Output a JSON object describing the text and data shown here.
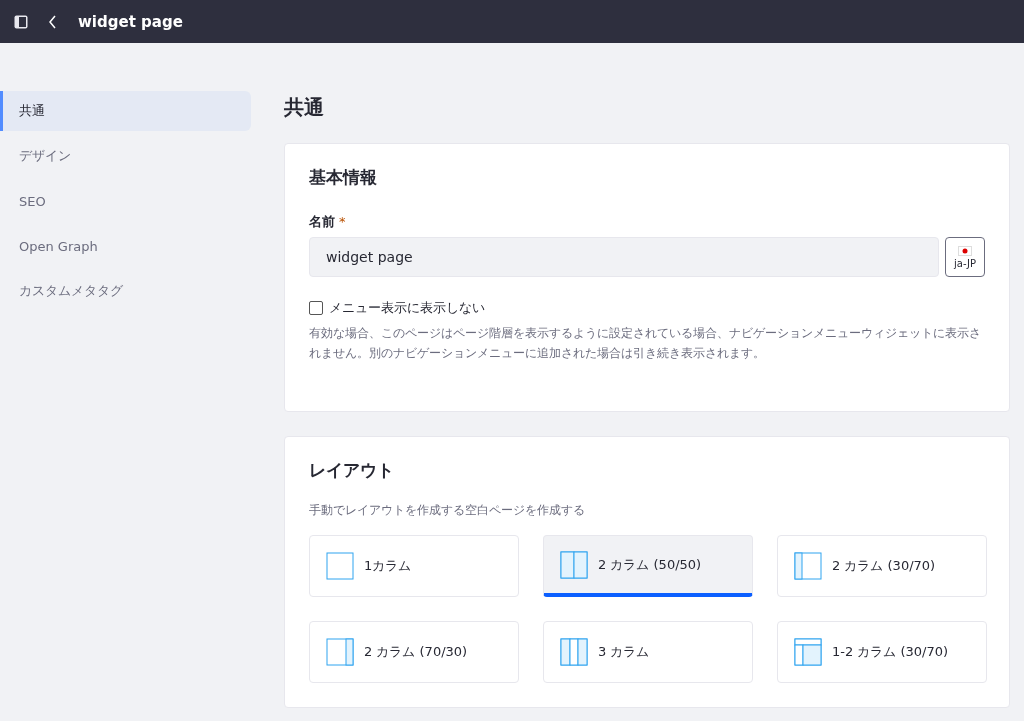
{
  "header": {
    "title": "widget page"
  },
  "sidebar": {
    "items": [
      {
        "label": "共通",
        "selected": true
      },
      {
        "label": "デザイン",
        "selected": false
      },
      {
        "label": "SEO",
        "selected": false
      },
      {
        "label": "Open Graph",
        "selected": false
      },
      {
        "label": "カスタムメタタグ",
        "selected": false
      }
    ]
  },
  "page_title": "共通",
  "basic_info": {
    "heading": "基本情報",
    "name_label": "名前",
    "required_mark": "*",
    "name_value": "widget page",
    "locale": "ja-JP",
    "hide_checkbox": {
      "label": "メニュー表示に表示しない",
      "checked": false
    },
    "help": "有効な場合、このページはページ階層を表示するように設定されている場合、ナビゲーションメニューウィジェットに表示されません。別のナビゲーションメニューに追加された場合は引き続き表示されます。"
  },
  "layout": {
    "heading": "レイアウト",
    "description": "手動でレイアウトを作成する空白ページを作成する",
    "options": [
      {
        "kind": "one",
        "label": "1カラム",
        "selected": false
      },
      {
        "kind": "half",
        "label": "2 カラム (50/50)",
        "selected": true
      },
      {
        "kind": "left",
        "label": "2 カラム (30/70)",
        "selected": false
      },
      {
        "kind": "right",
        "label": "2 カラム (70/30)",
        "selected": false
      },
      {
        "kind": "three",
        "label": "3 カラム",
        "selected": false
      },
      {
        "kind": "top",
        "label": "1-2 カラム (30/70)",
        "selected": false
      }
    ]
  }
}
